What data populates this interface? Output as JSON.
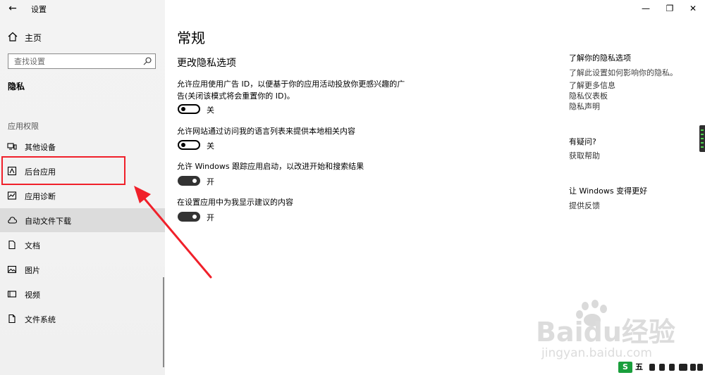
{
  "window": {
    "title": "设置",
    "minimize": "—",
    "maximize": "❐",
    "close": "✕"
  },
  "sidebar": {
    "home": "主页",
    "search_placeholder": "查找设置",
    "section": "隐私",
    "group": "应用权限",
    "items": [
      {
        "label": "其他设备",
        "icon": "devices-icon"
      },
      {
        "label": "后台应用",
        "icon": "background-apps-icon"
      },
      {
        "label": "应用诊断",
        "icon": "diagnostics-icon"
      },
      {
        "label": "自动文件下载",
        "icon": "cloud-icon"
      },
      {
        "label": "文档",
        "icon": "document-icon"
      },
      {
        "label": "图片",
        "icon": "picture-icon"
      },
      {
        "label": "视频",
        "icon": "video-icon"
      },
      {
        "label": "文件系统",
        "icon": "file-icon"
      }
    ]
  },
  "main": {
    "title": "常规",
    "subtitle": "更改隐私选项",
    "settings": [
      {
        "desc": "允许应用使用广告 ID，以便基于你的应用活动投放你更感兴趣的广告(关闭该模式将会重置你的 ID)。",
        "state": "关",
        "on": false
      },
      {
        "desc": "允许网站通过访问我的语言列表来提供本地相关内容",
        "state": "关",
        "on": false
      },
      {
        "desc": "允许 Windows 跟踪应用启动，以改进开始和搜索结果",
        "state": "开",
        "on": true
      },
      {
        "desc": "在设置应用中为我显示建议的内容",
        "state": "开",
        "on": true
      }
    ]
  },
  "right": {
    "privacy_head": "了解你的隐私选项",
    "privacy_text": "了解此设置如何影响你的隐私。",
    "links": [
      "了解更多信息",
      "隐私仪表板",
      "隐私声明"
    ],
    "question_head": "有疑问?",
    "help_link": "获取帮助",
    "better_head": "让 Windows 变得更好",
    "feedback_link": "提供反馈"
  },
  "watermark": {
    "brand": "Baidu经验",
    "url": "jingyan.baidu.com"
  },
  "tray": {
    "logo": "S",
    "ime": "五"
  },
  "colors": {
    "highlight": "#f0202a",
    "sidebar_bg": "#f2f2f2",
    "hover_bg": "#dcdcdc"
  }
}
